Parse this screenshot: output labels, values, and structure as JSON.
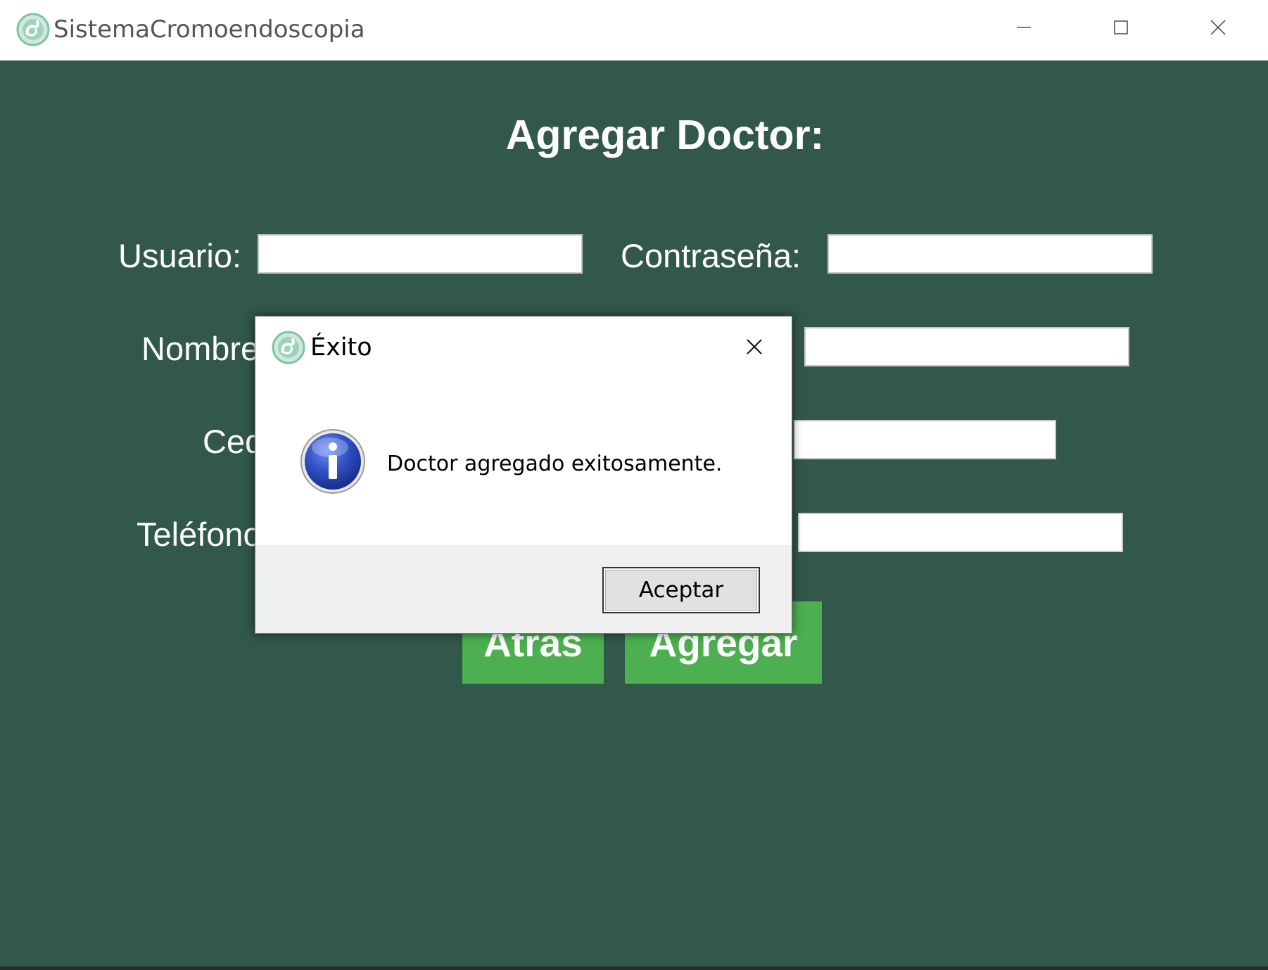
{
  "window": {
    "title": "SistemaCromoendoscopia",
    "icon": "app-logo-icon",
    "controls": [
      "minimize-icon",
      "maximize-icon",
      "close-icon"
    ]
  },
  "form": {
    "title": "Agregar Doctor:",
    "fields": {
      "usuario": {
        "label": "Usuario:",
        "value": ""
      },
      "contrasena": {
        "label": "Contraseña:",
        "value": ""
      },
      "nombre": {
        "label": "Nombre",
        "value": ""
      },
      "field_right_2": {
        "value": ""
      },
      "cedula": {
        "label": "Ced",
        "value": ""
      },
      "field_right_3": {
        "value": ""
      },
      "telefono": {
        "label": "Teléfono",
        "value": ""
      },
      "field_right_4": {
        "value": ""
      }
    },
    "buttons": {
      "back": "Atras",
      "add": "Agregar"
    }
  },
  "dialog": {
    "title": "Éxito",
    "message": "Doctor agregado exitosamente.",
    "ok_label": "Aceptar",
    "icon": "info-icon"
  },
  "colors": {
    "background": "#32574b",
    "button_green": "#4caf50",
    "text": "#ffffff"
  }
}
